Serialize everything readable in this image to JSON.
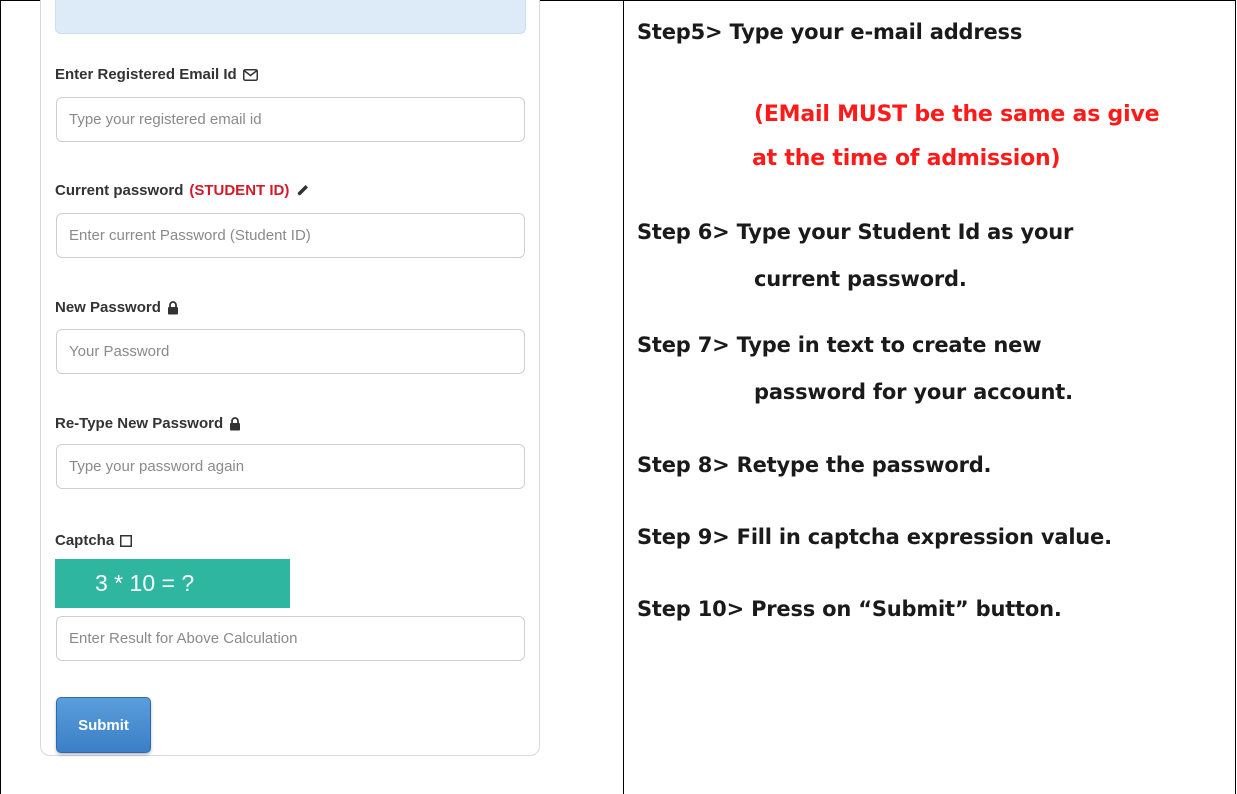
{
  "form": {
    "email": {
      "label": "Enter Registered Email Id",
      "icon": "envelope-icon",
      "placeholder": "Type your registered email id"
    },
    "current_password": {
      "label": "Current password",
      "label_highlight": "(STUDENT ID)",
      "highlight_color": "#d11a2a",
      "icon": "pencil-icon",
      "placeholder": "Enter current Password (Student ID)"
    },
    "new_password": {
      "label": "New Password",
      "icon": "lock-icon",
      "placeholder": "Your Password"
    },
    "retype_password": {
      "label": "Re-Type New Password",
      "icon": "lock-icon",
      "placeholder": "Type your password again"
    },
    "captcha": {
      "label": "Captcha",
      "icon": "square-icon",
      "expression": "3 * 10 = ?",
      "expression_bg": "#2eb6a0",
      "placeholder": "Enter Result for Above Calculation"
    },
    "submit_label": "Submit",
    "submit_color": "#3a7fc7"
  },
  "instructions": {
    "step5": "Step5>  Type your e-mail address",
    "note_line1": "(EMail MUST be the same as give",
    "note_line2": "at the time of admission)",
    "note_color": "#ff1a1a",
    "step6_line1": "Step 6> Type your Student Id as your",
    "step6_line2": "current password.",
    "step7_line1": "Step 7> Type in text to create new",
    "step7_line2": "password for your account.",
    "step8": "Step 8> Retype the password.",
    "step9": "Step 9> Fill in captcha expression value.",
    "step10": "Step 10> Press on “Submit” button."
  }
}
